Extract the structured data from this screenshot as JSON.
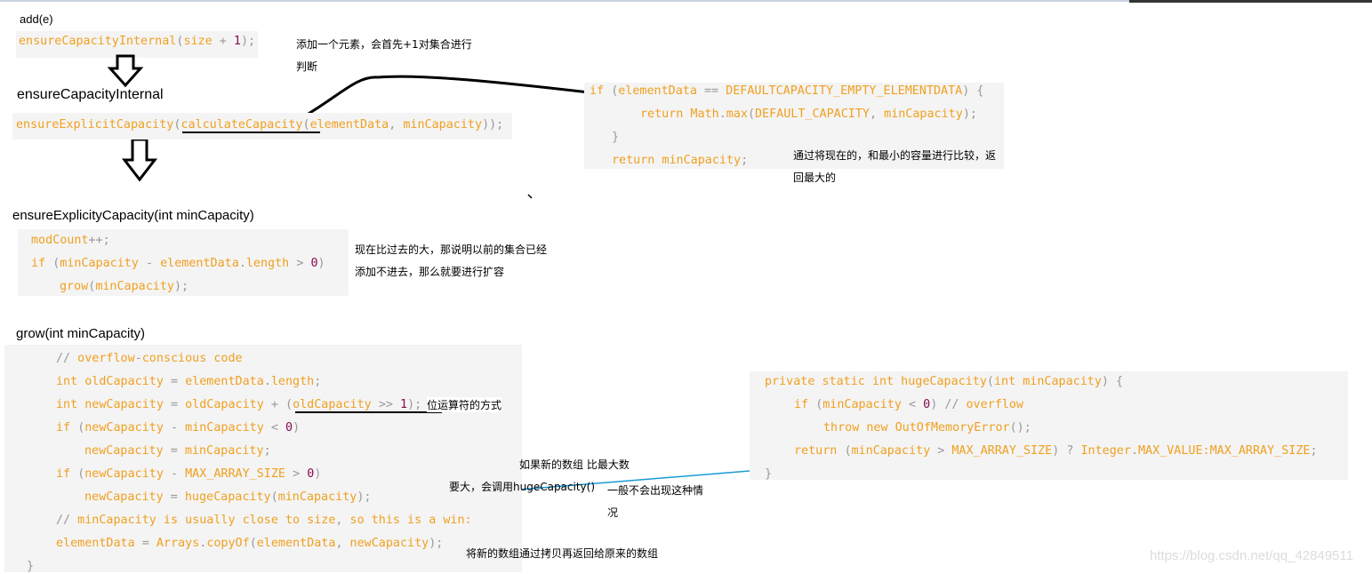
{
  "colors": {
    "code": "#f0a020",
    "punctuation": "#999999",
    "number": "#8b0a50",
    "code_bg": "#f4f4f4",
    "highlight_box": "#1a9ad6"
  },
  "sections": {
    "add": {
      "title": "add(e)",
      "code": [
        "ensureCapacityInternal(size + 1);"
      ],
      "note": [
        "添加一个元素，会首先+1对集合进行",
        "判断"
      ]
    },
    "ensure_internal": {
      "title": "ensureCapacityInternal",
      "code": [
        "ensureExplicitCapacity(calculateCapacity(elementData, minCapacity));"
      ]
    },
    "calculate": {
      "code": [
        "if (elementData == DEFAULTCAPACITY_EMPTY_ELEMENTDATA) {",
        "return Math.max(DEFAULT_CAPACITY, minCapacity);",
        "}",
        "return minCapacity;"
      ],
      "note": [
        "通过将现在的，和最小的容量进行比较，返",
        "回最大的"
      ]
    },
    "ensure_explicit": {
      "title": "ensureExplicityCapacity(int minCapacity)",
      "code": [
        "modCount++;",
        "if (minCapacity - elementData.length > 0)",
        "grow(minCapacity);"
      ],
      "note": [
        "现在比过去的大，那说明以前的集合已经",
        "添加不进去，那么就要进行扩容"
      ]
    },
    "grow": {
      "title": "grow(int minCapacity)",
      "code": [
        "// overflow-conscious code",
        "int oldCapacity = elementData.length;",
        "int newCapacity = oldCapacity + (oldCapacity >> 1);",
        "if (newCapacity - minCapacity < 0)",
        "newCapacity = minCapacity;",
        "if (newCapacity - MAX_ARRAY_SIZE > 0)",
        "newCapacity = hugeCapacity(minCapacity);",
        "// minCapacity is usually close to size, so this is a win:",
        "elementData = Arrays.copyOf(elementData, newCapacity);",
        "}"
      ],
      "note_shift": "位运算符的方式",
      "note_max": [
        "如果新的数组 比最大数",
        "要大，会调用hugeCapacity()"
      ],
      "note_rare": [
        "一般不会出现这种情",
        "况"
      ],
      "note_copy": "将新的数组通过拷贝再返回给原来的数组"
    },
    "huge": {
      "code": [
        "private static int hugeCapacity(int minCapacity) {",
        "if (minCapacity < 0) // overflow",
        "throw new OutOfMemoryError();",
        "return (minCapacity > MAX_ARRAY_SIZE) ? Integer.MAX_VALUE:MAX_ARRAY_SIZE;",
        "}"
      ]
    }
  },
  "watermark": "https://blog.csdn.net/qq_42849511"
}
